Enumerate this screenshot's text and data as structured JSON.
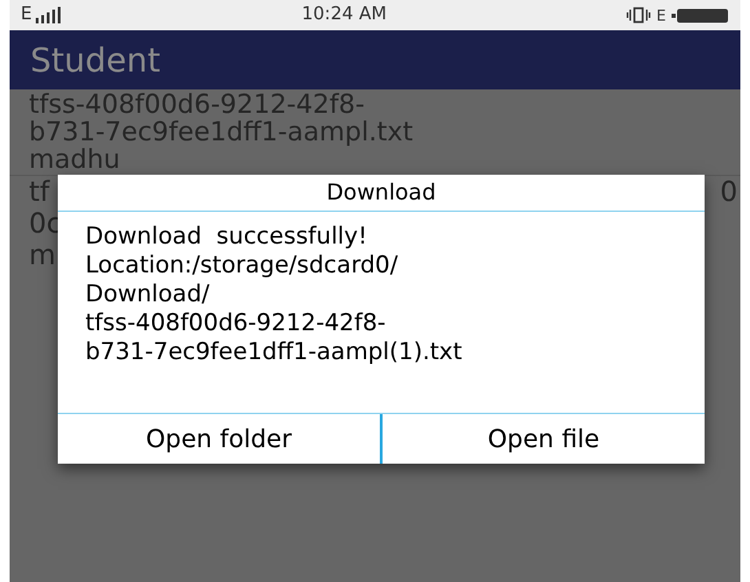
{
  "status_bar": {
    "network": "E",
    "time": "10:24 AM",
    "data": "E"
  },
  "app_bar": {
    "title": "Student"
  },
  "list": [
    {
      "title": [
        "tfss-408f00d6-9212-42f8-",
        "b731-7ec9fee1dff1-aampl.txt"
      ],
      "subtitle": "madhu"
    },
    {
      "lines": [
        "tf",
        "0c",
        "m"
      ],
      "edge": "0"
    }
  ],
  "dialog": {
    "title": "Download",
    "message": [
      "Download  successfully!",
      "Location:/storage/sdcard0/",
      "Download/",
      "tfss-408f00d6-9212-42f8-",
      "b731-7ec9fee1dff1-aampl(1).txt"
    ],
    "buttons": [
      "Open folder",
      "Open file"
    ]
  }
}
